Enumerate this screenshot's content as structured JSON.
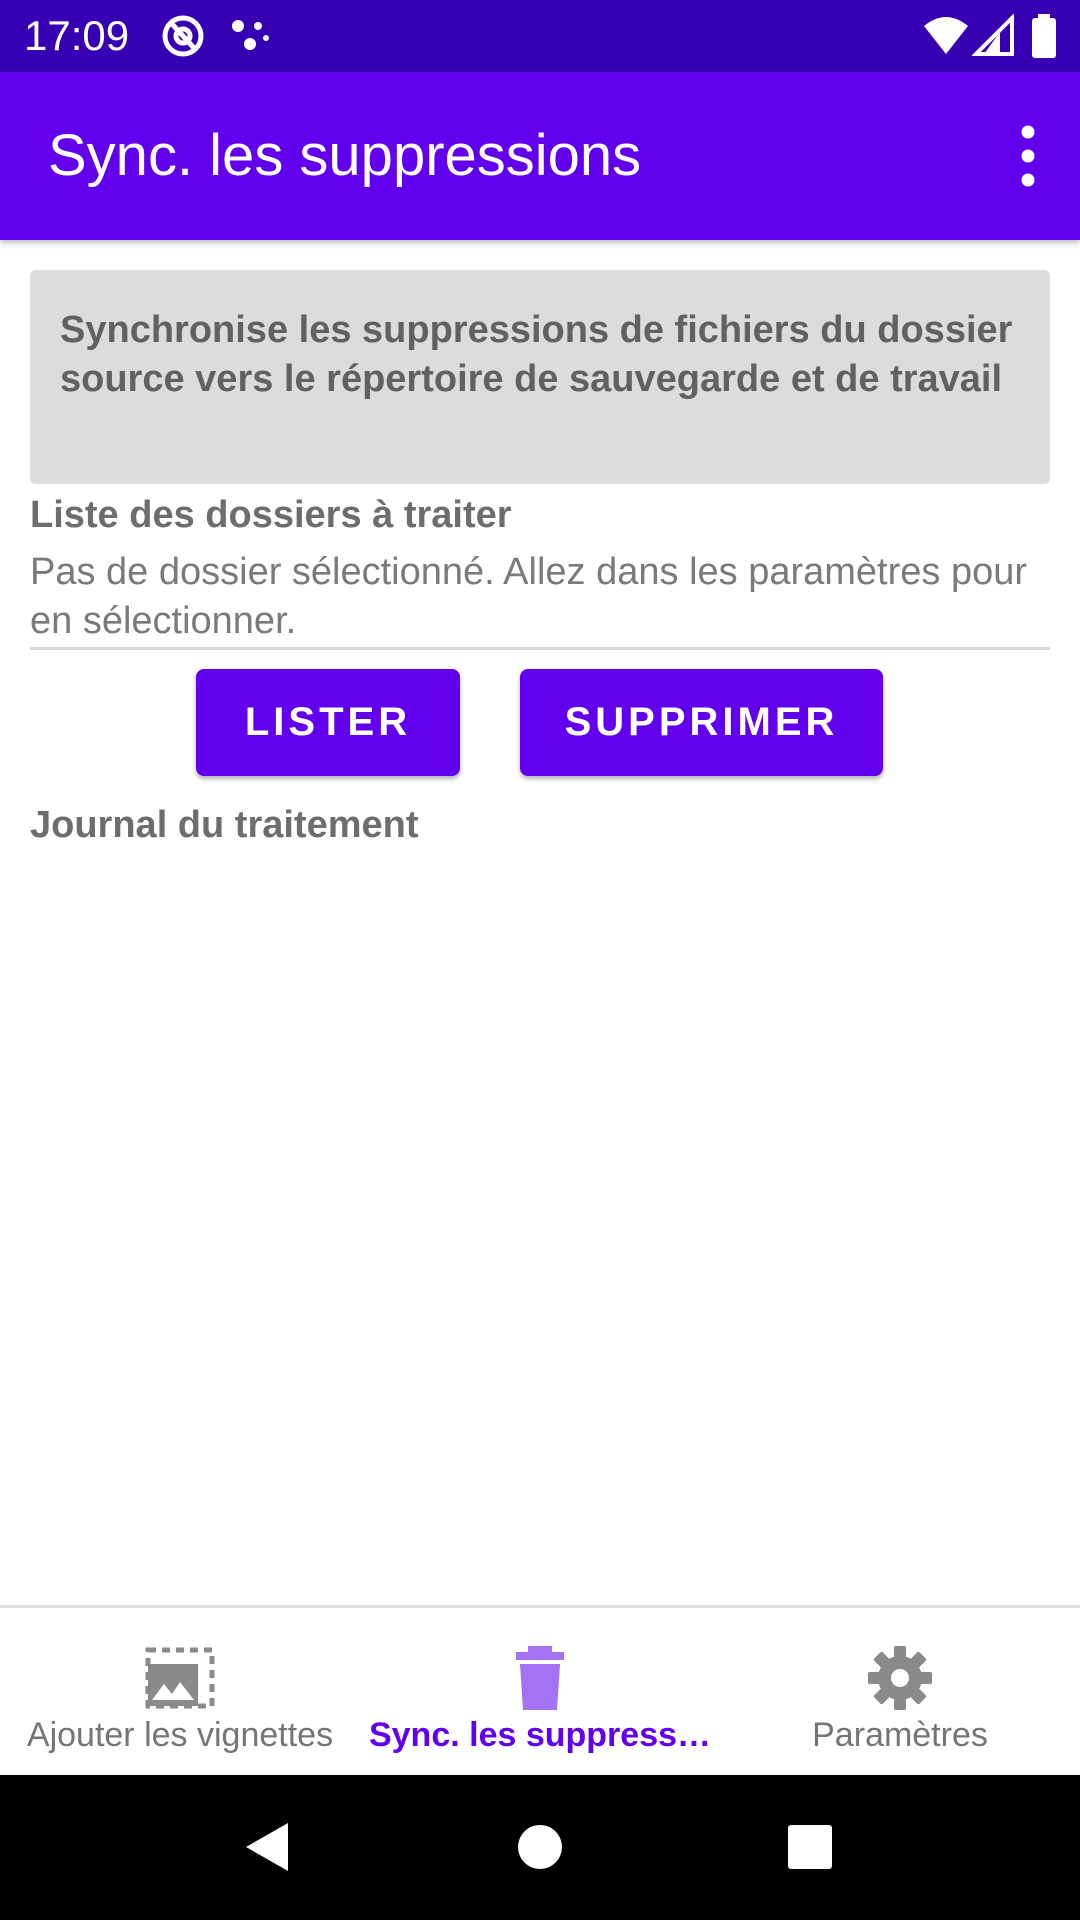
{
  "status_bar": {
    "time": "17:09",
    "left_icons": [
      "at-sign-icon",
      "dots-icon"
    ],
    "right_icons": [
      "wifi-icon",
      "signal-icon",
      "battery-icon"
    ]
  },
  "app_bar": {
    "title": "Sync. les suppressions",
    "menu_icon": "more-vert-icon"
  },
  "description": "Synchronise les suppressions de fichiers du dossier source vers le répertoire de sauvegarde et de travail",
  "folders": {
    "label": "Liste des dossiers à traiter",
    "value": "Pas de dossier sélectionné. Allez dans les paramètres pour en sélectionner."
  },
  "actions": {
    "list_label": "LISTER",
    "delete_label": "SUPPRIMER"
  },
  "log": {
    "label": "Journal du traitement"
  },
  "bottom_nav": {
    "items": [
      {
        "label": "Ajouter les vignettes",
        "icon": "image-selection-icon",
        "active": false
      },
      {
        "label": "Sync. les suppress…",
        "icon": "trash-icon",
        "active": true
      },
      {
        "label": "Paramètres",
        "icon": "gear-icon",
        "active": false
      }
    ]
  },
  "colors": {
    "status_bar": "#3700b3",
    "primary": "#6200ee",
    "card_background": "#dcdcdc",
    "system_nav": "#000000"
  }
}
